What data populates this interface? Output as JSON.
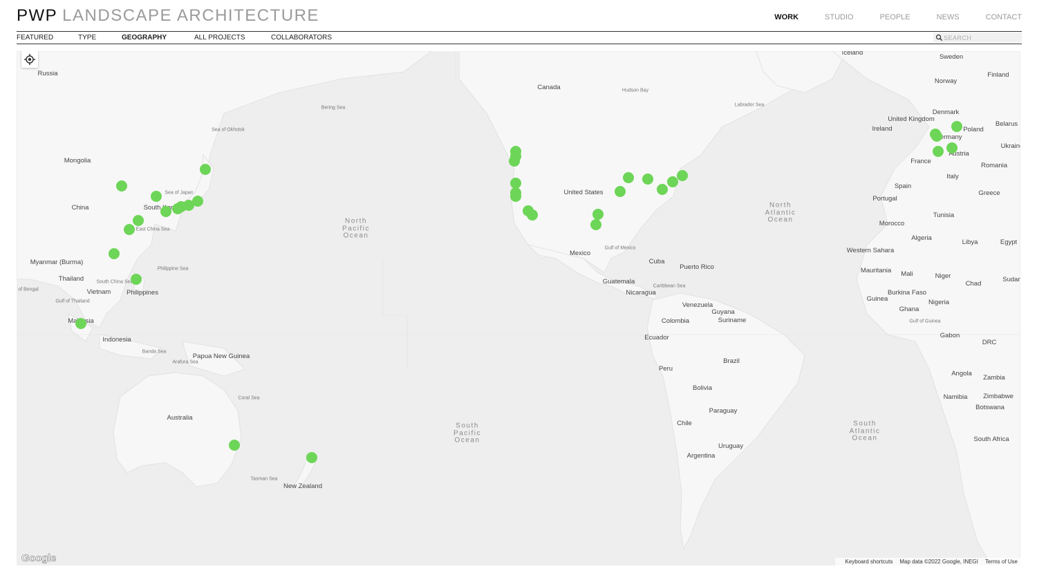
{
  "header": {
    "brand_main": "PWP",
    "brand_sub": "LANDSCAPE ARCHITECTURE",
    "nav": [
      {
        "label": "WORK",
        "active": true
      },
      {
        "label": "STUDIO",
        "active": false
      },
      {
        "label": "PEOPLE",
        "active": false
      },
      {
        "label": "NEWS",
        "active": false
      },
      {
        "label": "CONTACT",
        "active": false
      }
    ]
  },
  "subnav": {
    "items": [
      "FEATURED",
      "TYPE",
      "GEOGRAPHY",
      "ALL PROJECTS",
      "COLLABORATORS"
    ],
    "active": "GEOGRAPHY",
    "search_placeholder": "SEARCH"
  },
  "map": {
    "marker_color": "#6dd557",
    "labels": [
      "Russia",
      "Mongolia",
      "China",
      "South Korea",
      "Myanmar (Burma)",
      "Thailand",
      "Vietnam",
      "Philippines",
      "Malaysia",
      "Indonesia",
      "Papua New Guinea",
      "Australia",
      "New Zealand",
      "Canada",
      "United States",
      "Mexico",
      "Cuba",
      "Puerto Rico",
      "Guatemala",
      "Nicaragua",
      "Venezuela",
      "Colombia",
      "Guyana",
      "Suriname",
      "Ecuador",
      "Peru",
      "Brazil",
      "Bolivia",
      "Paraguay",
      "Chile",
      "Uruguay",
      "Argentina",
      "Iceland",
      "Sweden",
      "Finland",
      "Norway",
      "Denmark",
      "United Kingdom",
      "Ireland",
      "Poland",
      "Belarus",
      "Germany",
      "France",
      "Austria",
      "Ukraine",
      "Romania",
      "Italy",
      "Spain",
      "Portugal",
      "Greece",
      "Tunisia",
      "Morocco",
      "Algeria",
      "Libya",
      "Egypt",
      "Western Sahara",
      "Mauritania",
      "Mali",
      "Niger",
      "Chad",
      "Sudan",
      "Burkina Faso",
      "Guinea",
      "Nigeria",
      "Ghana",
      "Gabon",
      "DRC",
      "Angola",
      "Zambia",
      "Namibia",
      "Zimbabwe",
      "Botswana",
      "South Africa"
    ],
    "water_labels": [
      "Sea of Okhotsk",
      "Sea of Japan",
      "East China Sea",
      "Philippine Sea",
      "South China Sea",
      "Gulf of Thailand",
      "Bay of Bengal",
      "Banda Sea",
      "Arafura Sea",
      "Coral Sea",
      "Tasman Sea",
      "Bering Sea",
      "Hudson Bay",
      "Labrador Sea",
      "Gulf of Mexico",
      "Caribbean Sea",
      "Gulf of Guinea",
      "North Pacific Ocean",
      "South Pacific Ocean",
      "North Atlantic Ocean",
      "South Atlantic Ocean"
    ],
    "markers": 45
  },
  "footer": {
    "google": "Google",
    "keyboard": "Keyboard shortcuts",
    "mapdata": "Map data ©2022 Google, INEGI",
    "terms": "Terms of Use"
  }
}
